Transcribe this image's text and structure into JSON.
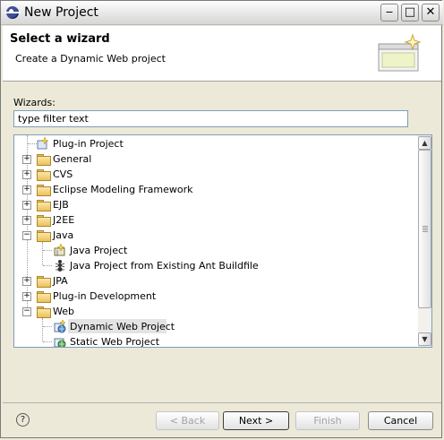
{
  "window": {
    "title": "New Project",
    "minimize": "‒",
    "maximize": "□",
    "close": "✕"
  },
  "header": {
    "title": "Select a wizard",
    "description": "Create a Dynamic Web project"
  },
  "wizards": {
    "label": "Wizards:",
    "filter_value": "type filter text",
    "tree": [
      {
        "label": "Plug-in Project",
        "icon": "plugin-project-icon"
      },
      {
        "label": "General",
        "icon": "folder-icon",
        "expander": "+"
      },
      {
        "label": "CVS",
        "icon": "folder-icon",
        "expander": "+"
      },
      {
        "label": "Eclipse Modeling Framework",
        "icon": "folder-icon",
        "expander": "+"
      },
      {
        "label": "EJB",
        "icon": "folder-icon",
        "expander": "+"
      },
      {
        "label": "J2EE",
        "icon": "folder-icon",
        "expander": "+"
      },
      {
        "label": "Java",
        "icon": "folder-icon",
        "expander": "−"
      },
      {
        "label": "Java Project",
        "icon": "java-project-icon"
      },
      {
        "label": "Java Project from Existing Ant Buildfile",
        "icon": "ant-project-icon"
      },
      {
        "label": "JPA",
        "icon": "folder-icon",
        "expander": "+"
      },
      {
        "label": "Plug-in Development",
        "icon": "folder-icon",
        "expander": "+"
      },
      {
        "label": "Web",
        "icon": "folder-icon",
        "expander": "−"
      },
      {
        "label": "Dynamic Web Project",
        "icon": "dynamic-web-project-icon",
        "selected": true
      },
      {
        "label": "Static Web Project",
        "icon": "static-web-project-icon"
      }
    ]
  },
  "buttons": {
    "help": "?",
    "back": "< Back",
    "next": "Next >",
    "finish": "Finish",
    "cancel": "Cancel"
  },
  "colors": {
    "selection": "#e3e3e3",
    "field_border": "#7f9db9",
    "folder": "#ebc25a"
  }
}
